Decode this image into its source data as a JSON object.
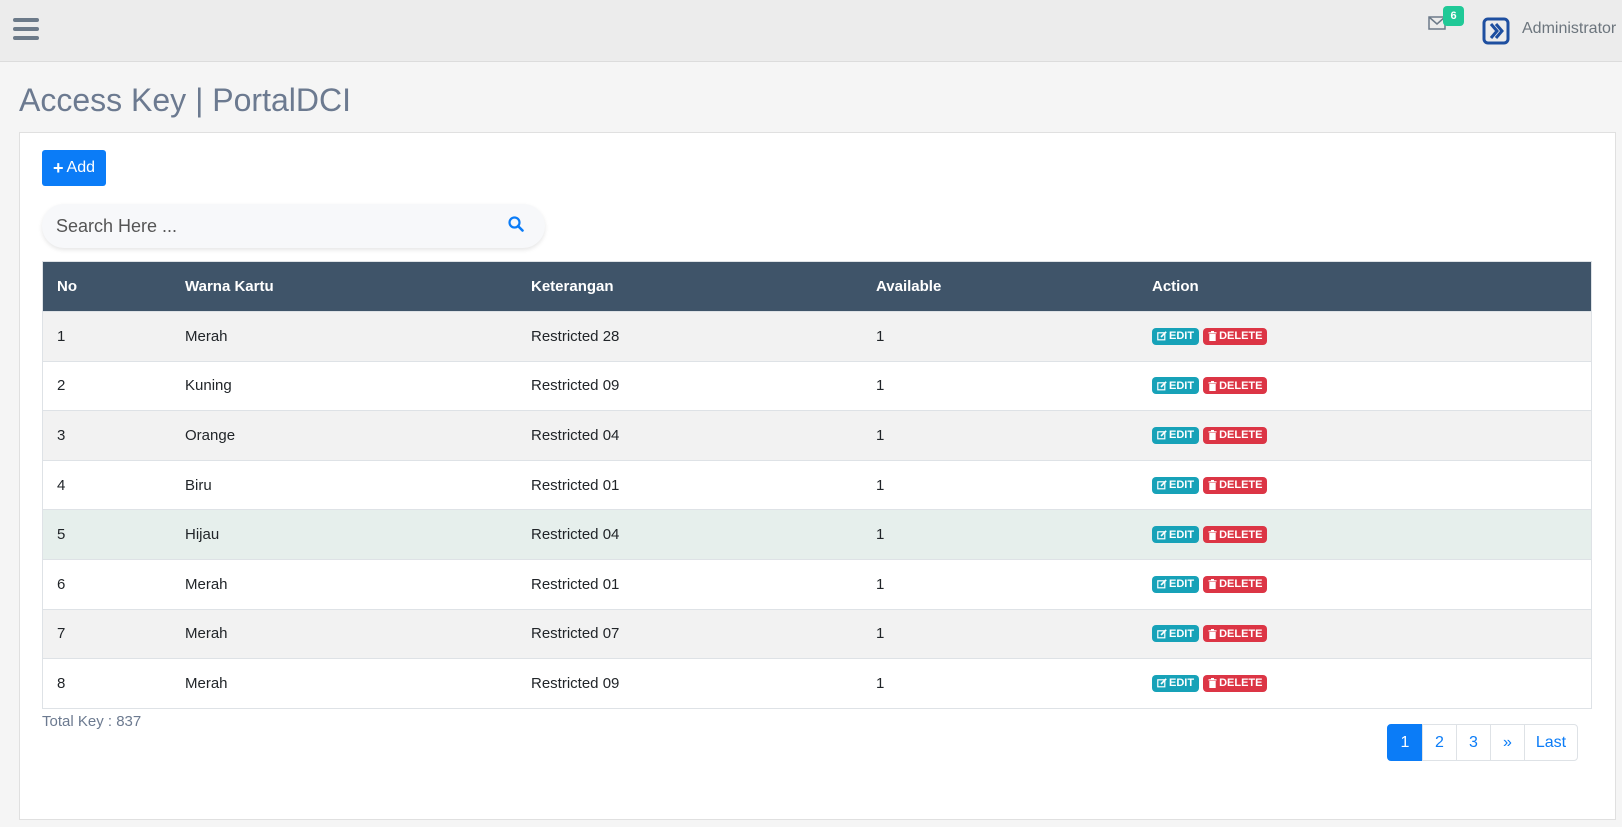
{
  "header": {
    "notification_count": "6",
    "user_name": "Administrator"
  },
  "page": {
    "title": "Access Key | PortalDCI"
  },
  "toolbar": {
    "add_label": "Add"
  },
  "search": {
    "placeholder": "Search Here ..."
  },
  "table": {
    "columns": [
      "No",
      "Warna Kartu",
      "Keterangan",
      "Available",
      "Action"
    ],
    "rows": [
      {
        "no": "1",
        "warna": "Merah",
        "keterangan": "Restricted 28",
        "available": "1"
      },
      {
        "no": "2",
        "warna": "Kuning",
        "keterangan": "Restricted 09",
        "available": "1"
      },
      {
        "no": "3",
        "warna": "Orange",
        "keterangan": "Restricted 04",
        "available": "1"
      },
      {
        "no": "4",
        "warna": "Biru",
        "keterangan": "Restricted 01",
        "available": "1"
      },
      {
        "no": "5",
        "warna": "Hijau",
        "keterangan": "Restricted 04",
        "available": "1"
      },
      {
        "no": "6",
        "warna": "Merah",
        "keterangan": "Restricted 01",
        "available": "1"
      },
      {
        "no": "7",
        "warna": "Merah",
        "keterangan": "Restricted 07",
        "available": "1"
      },
      {
        "no": "8",
        "warna": "Merah",
        "keterangan": "Restricted 09",
        "available": "1"
      }
    ],
    "edit_label": "EDIT",
    "delete_label": "DELETE"
  },
  "footer": {
    "total_text": "Total Key : 837"
  },
  "pagination": {
    "pages": [
      "1",
      "2",
      "3",
      "»",
      "Last"
    ],
    "active": "1"
  },
  "colors": {
    "primary": "#0b7cf7",
    "table_header": "#3f5469",
    "edit": "#17a2b8",
    "delete": "#dc3545",
    "badge": "#20c997"
  }
}
